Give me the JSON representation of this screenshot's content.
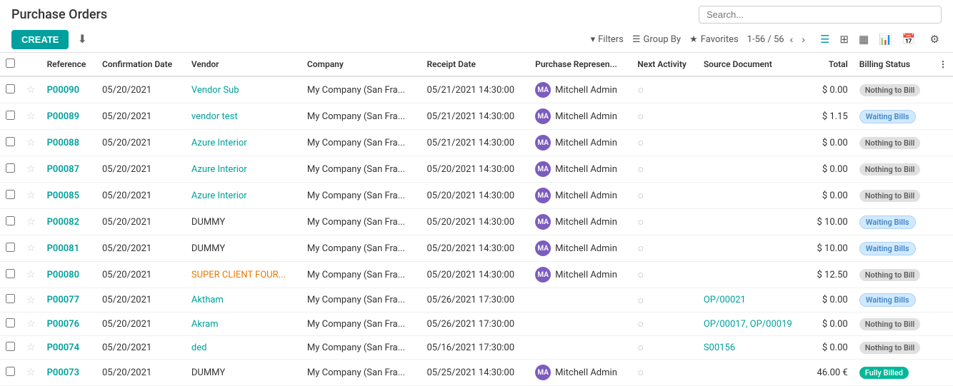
{
  "header": {
    "title": "Purchase Orders",
    "search_placeholder": "Search...",
    "create_label": "CREATE",
    "filters_label": "Filters",
    "groupby_label": "Group By",
    "favorites_label": "Favorites",
    "pager": "1-56 / 56"
  },
  "columns": [
    {
      "key": "reference",
      "label": "Reference"
    },
    {
      "key": "confirmation_date",
      "label": "Confirmation Date"
    },
    {
      "key": "vendor",
      "label": "Vendor"
    },
    {
      "key": "company",
      "label": "Company"
    },
    {
      "key": "receipt_date",
      "label": "Receipt Date"
    },
    {
      "key": "purchase_rep",
      "label": "Purchase Represen..."
    },
    {
      "key": "next_activity",
      "label": "Next Activity"
    },
    {
      "key": "source_document",
      "label": "Source Document"
    },
    {
      "key": "total",
      "label": "Total"
    },
    {
      "key": "billing_status",
      "label": "Billing Status"
    }
  ],
  "rows": [
    {
      "ref": "P00090",
      "conf_date": "05/20/2021",
      "vendor": "Vendor Sub",
      "company": "My Company (San Fra...",
      "receipt_date": "05/21/2021 14:30:00",
      "rep": "Mitchell Admin",
      "rep_initials": "MA",
      "next_activity": "",
      "source_doc": "",
      "total": "$ 0.00",
      "billing": "Nothing to Bill",
      "billing_type": "nothing"
    },
    {
      "ref": "P00089",
      "conf_date": "05/20/2021",
      "vendor": "vendor test",
      "company": "My Company (San Fra...",
      "receipt_date": "05/21/2021 14:30:00",
      "rep": "Mitchell Admin",
      "rep_initials": "MA",
      "next_activity": "",
      "source_doc": "",
      "total": "$ 1.15",
      "billing": "Waiting Bills",
      "billing_type": "waiting"
    },
    {
      "ref": "P00088",
      "conf_date": "05/20/2021",
      "vendor": "Azure Interior",
      "company": "My Company (San Fra...",
      "receipt_date": "05/21/2021 14:30:00",
      "rep": "Mitchell Admin",
      "rep_initials": "MA",
      "next_activity": "",
      "source_doc": "",
      "total": "$ 0.00",
      "billing": "Nothing to Bill",
      "billing_type": "nothing"
    },
    {
      "ref": "P00087",
      "conf_date": "05/20/2021",
      "vendor": "Azure Interior",
      "company": "My Company (San Fra...",
      "receipt_date": "05/20/2021 14:30:00",
      "rep": "Mitchell Admin",
      "rep_initials": "MA",
      "next_activity": "",
      "source_doc": "",
      "total": "$ 0.00",
      "billing": "Nothing to Bill",
      "billing_type": "nothing"
    },
    {
      "ref": "P00085",
      "conf_date": "05/20/2021",
      "vendor": "Azure Interior",
      "company": "My Company (San Fra...",
      "receipt_date": "05/20/2021 14:30:00",
      "rep": "Mitchell Admin",
      "rep_initials": "MA",
      "next_activity": "",
      "source_doc": "",
      "total": "$ 0.00",
      "billing": "Nothing to Bill",
      "billing_type": "nothing"
    },
    {
      "ref": "P00082",
      "conf_date": "05/20/2021",
      "vendor": "DUMMY",
      "company": "My Company (San Fra...",
      "receipt_date": "05/20/2021 14:30:00",
      "rep": "Mitchell Admin",
      "rep_initials": "MA",
      "next_activity": "",
      "source_doc": "",
      "total": "$ 10.00",
      "billing": "Waiting Bills",
      "billing_type": "waiting"
    },
    {
      "ref": "P00081",
      "conf_date": "05/20/2021",
      "vendor": "DUMMY",
      "company": "My Company (San Fra...",
      "receipt_date": "05/20/2021 14:30:00",
      "rep": "Mitchell Admin",
      "rep_initials": "MA",
      "next_activity": "",
      "source_doc": "",
      "total": "$ 10.00",
      "billing": "Waiting Bills",
      "billing_type": "waiting"
    },
    {
      "ref": "P00080",
      "conf_date": "05/20/2021",
      "vendor": "SUPER CLIENT FOUR...",
      "company": "My Company (San Fra...",
      "receipt_date": "05/20/2021 14:30:00",
      "rep": "Mitchell Admin",
      "rep_initials": "MA",
      "next_activity": "",
      "source_doc": "",
      "total": "$ 12.50",
      "billing": "Nothing to Bill",
      "billing_type": "nothing"
    },
    {
      "ref": "P00077",
      "conf_date": "05/20/2021",
      "vendor": "Aktham",
      "company": "My Company (San Fra...",
      "receipt_date": "05/26/2021 17:30:00",
      "rep": "",
      "rep_initials": "",
      "next_activity": "",
      "source_doc": "OP/00021",
      "total": "$ 0.00",
      "billing": "Waiting Bills",
      "billing_type": "waiting"
    },
    {
      "ref": "P00076",
      "conf_date": "05/20/2021",
      "vendor": "Akram",
      "company": "My Company (San Fra...",
      "receipt_date": "05/26/2021 17:30:00",
      "rep": "",
      "rep_initials": "",
      "next_activity": "",
      "source_doc": "OP/00017, OP/00019",
      "total": "$ 0.00",
      "billing": "Nothing to Bill",
      "billing_type": "nothing"
    },
    {
      "ref": "P00074",
      "conf_date": "05/20/2021",
      "vendor": "ded",
      "company": "My Company (San Fra...",
      "receipt_date": "05/16/2021 17:30:00",
      "rep": "",
      "rep_initials": "",
      "next_activity": "",
      "source_doc": "S00156",
      "total": "$ 0.00",
      "billing": "Nothing to Bill",
      "billing_type": "nothing"
    },
    {
      "ref": "P00073",
      "conf_date": "05/20/2021",
      "vendor": "DUMMY",
      "company": "My Company (San Fra...",
      "receipt_date": "05/25/2021 14:30:00",
      "rep": "Mitchell Admin",
      "rep_initials": "MA",
      "next_activity": "",
      "source_doc": "",
      "total": "46.00 €",
      "billing": "Fully Billed",
      "billing_type": "fully"
    }
  ]
}
